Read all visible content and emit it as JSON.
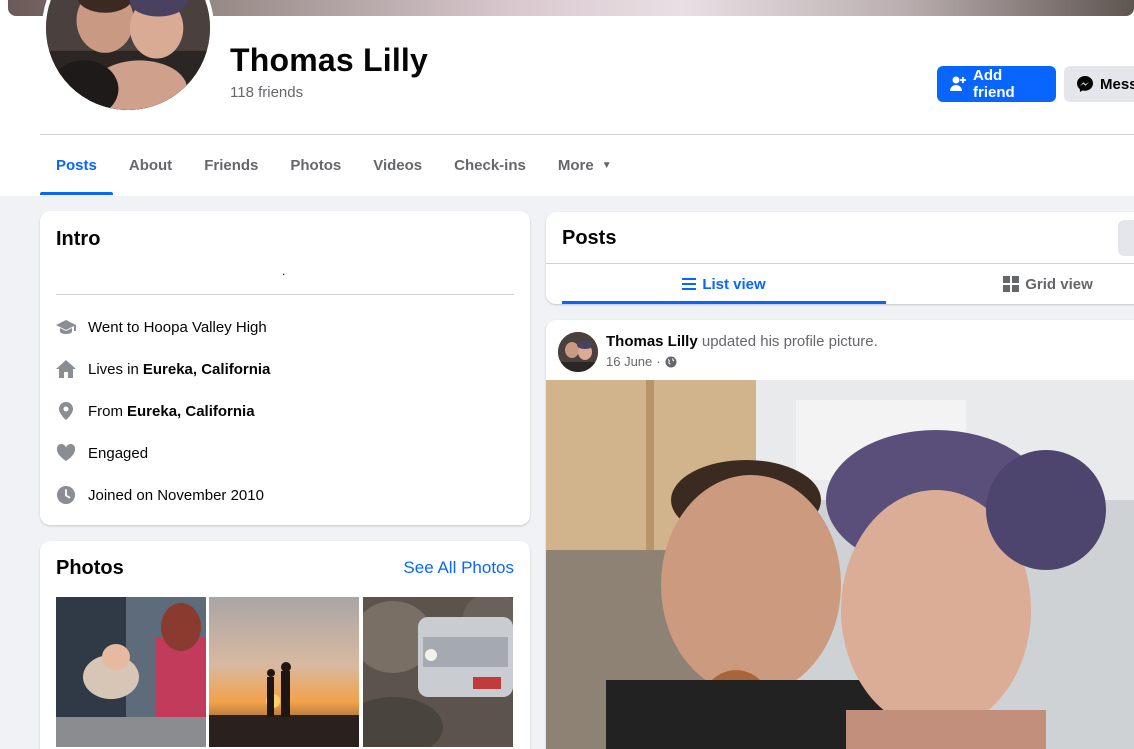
{
  "profile": {
    "name": "Thomas Lilly",
    "friends_count": "118 friends",
    "actions": {
      "add_friend": "Add friend",
      "message": "Messa"
    }
  },
  "tabs": [
    {
      "label": "Posts",
      "active": true
    },
    {
      "label": "About"
    },
    {
      "label": "Friends"
    },
    {
      "label": "Photos"
    },
    {
      "label": "Videos"
    },
    {
      "label": "Check-ins"
    },
    {
      "label": "More"
    }
  ],
  "intro": {
    "title": "Intro",
    "bio": ".",
    "items": [
      {
        "icon": "graduation-cap-icon",
        "text": "Went to Hoopa Valley High",
        "bold": ""
      },
      {
        "icon": "home-icon",
        "text": "Lives in",
        "bold": "Eureka, California"
      },
      {
        "icon": "location-pin-icon",
        "text": "From",
        "bold": "Eureka, California"
      },
      {
        "icon": "heart-icon",
        "text": "Engaged",
        "bold": ""
      },
      {
        "icon": "clock-icon",
        "text": "Joined on November 2010",
        "bold": ""
      }
    ]
  },
  "photos": {
    "title": "Photos",
    "see_all": "See All Photos"
  },
  "posts": {
    "title": "Posts",
    "list_view": "List view",
    "grid_view": "Grid view"
  },
  "post": {
    "author": "Thomas Lilly",
    "action": "updated his profile picture.",
    "date": "16 June",
    "separator": "·",
    "audience_icon": "globe-icon"
  },
  "colors": {
    "accent": "#0866ff",
    "background": "#f0f2f5",
    "secondary_text": "#65676b"
  }
}
